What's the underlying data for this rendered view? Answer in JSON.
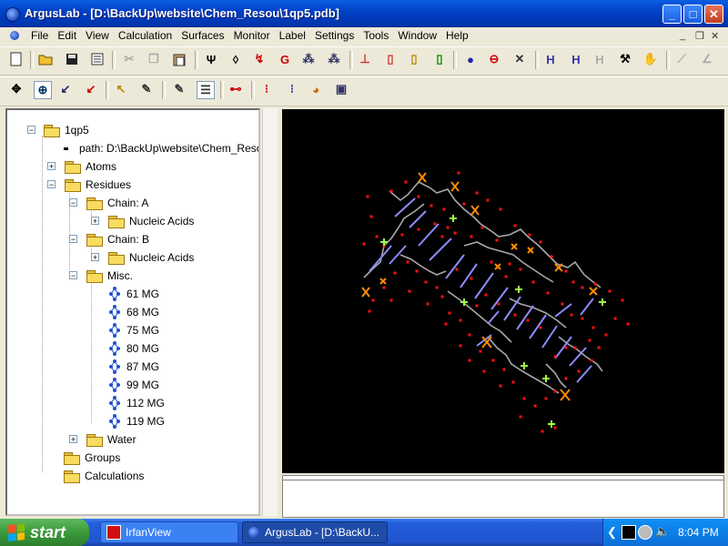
{
  "window": {
    "title": "ArgusLab - [D:\\BackUp\\website\\Chem_Resou\\1qp5.pdb]",
    "controls": [
      "minimize-icon",
      "maximize-icon",
      "close-icon"
    ]
  },
  "menu": {
    "items": [
      "File",
      "Edit",
      "View",
      "Calculation",
      "Surfaces",
      "Monitor",
      "Label",
      "Settings",
      "Tools",
      "Window",
      "Help"
    ]
  },
  "tree": {
    "root": "1qp5",
    "path": "path: D:\\BackUp\\website\\Chem_Resou",
    "atoms": "Atoms",
    "residues": "Residues",
    "chain_a": "Chain: A",
    "chain_a_child": "Nucleic Acids",
    "chain_b": "Chain: B",
    "chain_b_child": "Nucleic Acids",
    "misc": "Misc.",
    "misc_items": [
      "61 MG",
      "68 MG",
      "75 MG",
      "80 MG",
      "87 MG",
      "99 MG",
      "112 MG",
      "119 MG"
    ],
    "water": "Water",
    "groups": "Groups",
    "calculations": "Calculations"
  },
  "taskbar": {
    "start_label": "start",
    "items": [
      {
        "label": "IrfanView",
        "active": false
      },
      {
        "label": "ArgusLab - [D:\\BackU...",
        "active": true
      }
    ],
    "clock": "8:04 PM"
  },
  "colors": {
    "viewer_bg": "#000000",
    "water_oxygen": "#ff1010",
    "magnesium": "#99ff44",
    "backbone": "#a8a8a8",
    "base": "#8c8cff",
    "phosphate": "#ff8c00"
  }
}
